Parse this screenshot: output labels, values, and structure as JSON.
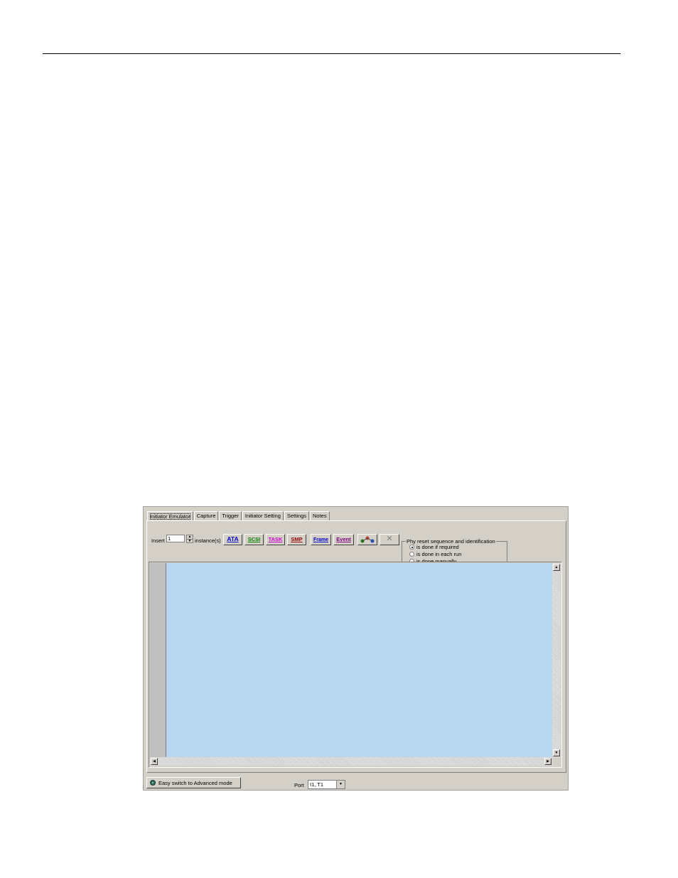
{
  "tabs": [
    "Initiator Emulator",
    "Capture",
    "Trigger",
    "Initiator Setting",
    "Settings",
    "Notes"
  ],
  "active_tab": "Initiator Emulator",
  "toolbar": {
    "insert_label": "Insert",
    "insert_value": "1",
    "instances_label": "instance(s)",
    "buttons": [
      {
        "label": "ATA",
        "color": "#0000cc"
      },
      {
        "label": "SCSI",
        "color": "#008000"
      },
      {
        "label": "TASK",
        "color": "#cc00cc"
      },
      {
        "label": "SMP",
        "color": "#990000"
      },
      {
        "label": "Frame",
        "color": "#0000cc"
      },
      {
        "label": "Event",
        "color": "#800080"
      }
    ]
  },
  "phy_group": {
    "title": "Phy reset sequence and identification",
    "options": [
      "is done if required",
      "is done in each run",
      "is done manually"
    ],
    "selected": "is done if required"
  },
  "footer": {
    "mode_button_label": "Easy switch to Advanced mode",
    "port_label": "Port",
    "port_value": "I1, T1"
  },
  "colors": {
    "list_background": "#b8d6f0",
    "window_background": "#d4d0c8"
  }
}
